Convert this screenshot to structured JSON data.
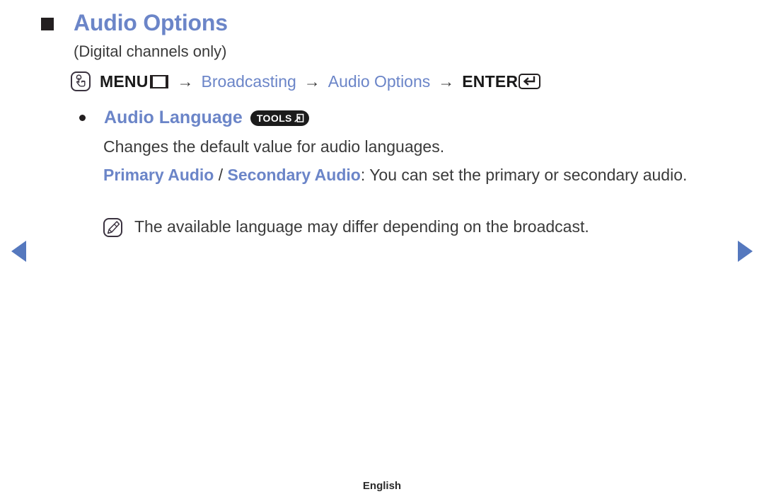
{
  "heading": {
    "bullet_icon": "square-bullet-icon",
    "title": "Audio Options",
    "subtitle": "(Digital channels only)"
  },
  "menu_path": {
    "oo_icon": "hand-press-button-icon",
    "menu_label": "MENU",
    "menu_glyph_icon": "menu-grid-icon",
    "arrow": "→",
    "step_broadcasting": "Broadcasting",
    "step_audio_options": "Audio Options",
    "enter_label": "ENTER",
    "enter_glyph_icon": "enter-return-icon"
  },
  "option": {
    "dot_icon": "round-bullet-icon",
    "label": "Audio Language",
    "badge_text": "TOOLS",
    "badge_glyph_icon": "tools-arrow-icon",
    "description": "Changes the default value for audio languages.",
    "detail": {
      "term_primary": "Primary Audio",
      "separator": " / ",
      "term_secondary": "Secondary Audio",
      "rest": ": You can set the primary or secondary audio."
    }
  },
  "note": {
    "icon": "note-pencil-icon",
    "text": "The available language may differ depending on the broadcast."
  },
  "navigation": {
    "prev_icon": "prev-page-arrow-icon",
    "next_icon": "next-page-arrow-icon"
  },
  "footer": {
    "language": "English"
  },
  "colors": {
    "accent_blue": "#6b85c8",
    "arrow_blue": "#5578be",
    "text_dark": "#3a3a3a",
    "badge_black": "#1c1c1c"
  }
}
